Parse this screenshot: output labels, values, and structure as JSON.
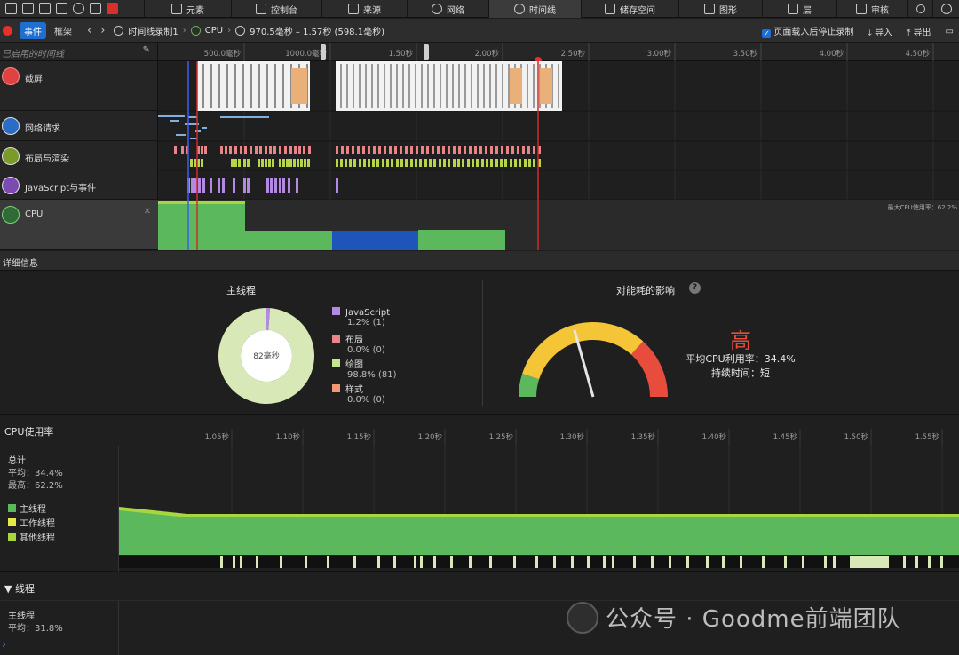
{
  "tabs": [
    {
      "label": "元素",
      "icon": "elements-icon"
    },
    {
      "label": "控制台",
      "icon": "console-icon"
    },
    {
      "label": "来源",
      "icon": "sources-icon"
    },
    {
      "label": "网络",
      "icon": "network-icon"
    },
    {
      "label": "时间线",
      "icon": "clock-icon",
      "active": true
    },
    {
      "label": "储存空间",
      "icon": "storage-icon"
    },
    {
      "label": "图形",
      "icon": "graphics-icon"
    },
    {
      "label": "层",
      "icon": "layers-icon"
    },
    {
      "label": "审核",
      "icon": "audit-icon"
    }
  ],
  "toolbar": {
    "mode_events": "事件",
    "mode_frames": "框架",
    "recording": "时间线录制1",
    "scope": "CPU",
    "range": "970.5毫秒 – 1.57秒 (598.1毫秒)",
    "stop_after_load": "页面载入后停止录制",
    "import": "导入",
    "export": "导出"
  },
  "filter_placeholder": "已启用的时间线",
  "ruler": {
    "ticks": [
      "500.0毫秒",
      "1000.0毫秒",
      "1.50秒",
      "2.00秒",
      "2.50秒",
      "3.00秒",
      "3.50秒",
      "4.00秒",
      "4.50秒"
    ]
  },
  "tracks": [
    {
      "label": "截屏",
      "icon": "camera-icon"
    },
    {
      "label": "网络请求",
      "icon": "network-arrows-icon"
    },
    {
      "label": "布局与渲染",
      "icon": "paintbrush-icon"
    },
    {
      "label": "JavaScript与事件",
      "icon": "script-icon"
    },
    {
      "label": "CPU",
      "icon": "cpu-icon"
    }
  ],
  "cpu_lane_max_label": "最大CPU使用率：62.2%",
  "details_title": "详细信息",
  "main_thread": {
    "title": "主线程",
    "center": "82毫秒",
    "legend": [
      {
        "name": "JavaScript",
        "value": "1.2% (1)",
        "color": "#b28ae3"
      },
      {
        "name": "布局",
        "value": "0.0% (0)",
        "color": "#e9848b"
      },
      {
        "name": "绘图",
        "value": "98.8% (81)",
        "color": "#c6e38d"
      },
      {
        "name": "样式",
        "value": "0.0% (0)",
        "color": "#ef9a73"
      }
    ],
    "share_percent": {
      "paint": 98.8,
      "javascript": 1.2,
      "layout": 0.0,
      "style": 0.0
    }
  },
  "energy": {
    "title": "对能耗的影响",
    "level": "高",
    "avg_label": "平均CPU利用率：34.4%",
    "duration_label": "持续时间：短",
    "needle_value": 34.4,
    "colors": {
      "low": "#5cb85c",
      "mid": "#f3c537",
      "high": "#e74c3c"
    }
  },
  "cpu_usage": {
    "title": "CPU使用率",
    "total_label": "总计",
    "avg": "平均：34.4%",
    "max": "最高：62.2%",
    "ticks": [
      "1.05秒",
      "1.10秒",
      "1.15秒",
      "1.20秒",
      "1.25秒",
      "1.30秒",
      "1.35秒",
      "1.40秒",
      "1.45秒",
      "1.50秒",
      "1.55秒"
    ],
    "legend": [
      {
        "name": "主线程",
        "color": "#5cb85c"
      },
      {
        "name": "工作线程",
        "color": "#e8e84a"
      },
      {
        "name": "其他线程",
        "color": "#a7d63d"
      }
    ]
  },
  "threads": {
    "title": "线程",
    "main_label": "主线程",
    "main_avg": "平均：31.8%"
  },
  "watermark": "公众号 · Goodme前端团队"
}
